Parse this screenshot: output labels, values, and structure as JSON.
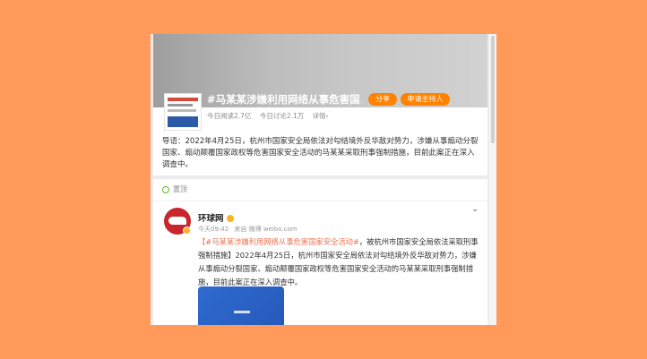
{
  "topic": {
    "title": "#马某某涉嫌利用网络从事危害国...",
    "share_label": "分享",
    "apply_host_label": "申请主持人",
    "stats": [
      "今日阅读2.7亿",
      "今日讨论2.1万",
      "详情›"
    ],
    "lead": "导语：2022年4月25日，杭州市国家安全局依法对勾结境外反华敌对势力，涉嫌从事煽动分裂国家、煽动颠覆国家政权等危害国家安全活动的马某某采取刑事强制措施，目前此案正在深入调查中。"
  },
  "feed": {
    "pinned_label": "置顶",
    "author": "环球网",
    "time": "今天09:42",
    "source": "来自 微博 weibo.com",
    "post_hashtag": "【#马某某涉嫌利用网络从事危害国家安全活动#",
    "post_text": "，被杭州市国家安全局依法采取刑事强制措施】2022年4月25日，杭州市国家安全局依法对勾结境外反华敌对势力，涉嫌从事煽动分裂国家、煽动颠覆国家政权等危害国家安全活动的马某某采取刑事强制措施，目前此案正在深入调查中。"
  },
  "colors": {
    "background": "#ff9a5a",
    "accent": "#ff8200",
    "hashtag": "#eb7350"
  }
}
